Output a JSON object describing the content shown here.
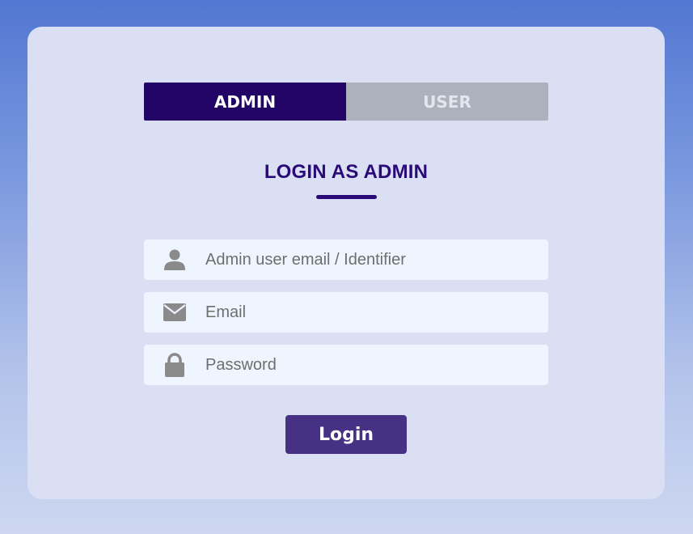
{
  "tabs": {
    "admin_label": "ADMIN",
    "user_label": "USER",
    "active": "ADMIN"
  },
  "form": {
    "heading": "LOGIN AS ADMIN",
    "identifier_placeholder": "Admin user email / Identifier",
    "email_placeholder": "Email",
    "password_placeholder": "Password",
    "submit_label": "Login"
  },
  "icons": {
    "identifier": "user-icon",
    "email": "envelope-icon",
    "password": "lock-icon"
  },
  "colors": {
    "accent": "#210465",
    "button": "#463184",
    "heading": "#2a0a78",
    "inactive_tab": "#adb1bb",
    "card": "#dbdff3",
    "field_bg": "#eef5ff",
    "icon": "#8a8a8a"
  }
}
